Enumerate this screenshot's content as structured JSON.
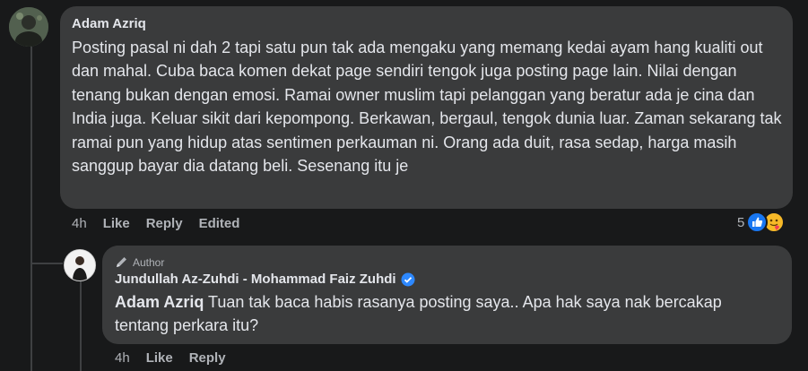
{
  "comment": {
    "author": "Adam Azriq",
    "text": "Posting pasal ni dah 2 tapi satu pun tak ada mengaku yang memang kedai ayam hang kualiti out dan mahal. Cuba baca komen dekat page sendiri tengok juga posting page lain. Nilai dengan tenang bukan dengan emosi. Ramai owner muslim tapi pelanggan yang beratur ada je cina dan India juga. Keluar sikit dari kepompong. Berkawan, bergaul, tengok dunia luar. Zaman sekarang tak ramai pun yang hidup atas sentimen perkauman ni. Orang ada duit, rasa sedap, harga masih sanggup bayar dia datang beli. Sesenang itu je",
    "time": "4h",
    "like_label": "Like",
    "reply_label": "Reply",
    "edited_label": "Edited",
    "reaction_count": "5",
    "reactions": [
      "like-icon",
      "care-icon"
    ]
  },
  "reply": {
    "badge": "Author",
    "author": "Jundullah Az-Zuhdi - Mohammad Faiz Zuhdi",
    "verified": true,
    "mention": "Adam Azriq",
    "text": " Tuan tak baca habis rasanya posting saya.. Apa hak saya nak bercakap tentang perkara itu?",
    "time": "4h",
    "like_label": "Like",
    "reply_label": "Reply"
  },
  "colors": {
    "background": "#18191a",
    "bubble": "#3a3b3c",
    "text": "#e4e6eb",
    "secondary": "#b0b3b8",
    "verified": "#2d88ff"
  }
}
